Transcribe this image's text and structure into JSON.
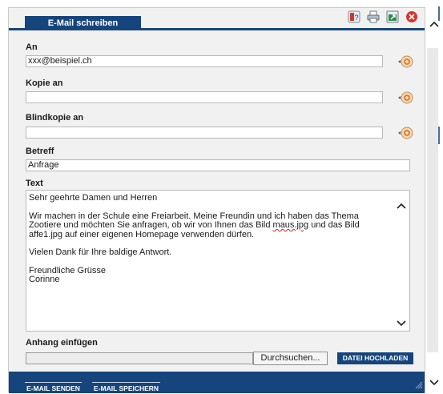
{
  "window": {
    "title": "E-Mail schreiben",
    "icons": [
      "help-icon",
      "print-icon",
      "popout-icon",
      "close-icon"
    ]
  },
  "fields": {
    "to": {
      "label": "An",
      "value": "xxx@beispiel.ch"
    },
    "cc": {
      "label": "Kopie an",
      "value": ""
    },
    "bcc": {
      "label": "Blindkopie an",
      "value": ""
    },
    "subject": {
      "label": "Betreff",
      "value": "Anfrage"
    },
    "text": {
      "label": "Text",
      "greeting": "Sehr geehrte Damen und Herren",
      "body_part1": "Wir machen in der Schule eine Freiarbeit. Meine Freundin und ich haben das Thema Zootiere und möchten Sie anfragen, ob wir von Ihnen das Bild ",
      "body_misspelled": "maus.jpg",
      "body_part2": " und das Bild affe1.jpg auf einer eigenen Homepage verwenden dürfen.",
      "thanks": "Vielen Dank für Ihre baldige Antwort.",
      "closing": "Freundliche Grüsse",
      "signature": "Corinne"
    }
  },
  "attachment": {
    "label": "Anhang einfügen",
    "file_value": "",
    "browse_label": "Durchsuchen...",
    "upload_label": "DATEI HOCHLADEN"
  },
  "footer": {
    "send_label": "E-MAIL SENDEN",
    "save_label": "E-MAIL SPEICHERN"
  },
  "colors": {
    "accent": "#16457d",
    "panel_bg": "#f1f1f1",
    "address_book_icon": "#e8822a"
  }
}
